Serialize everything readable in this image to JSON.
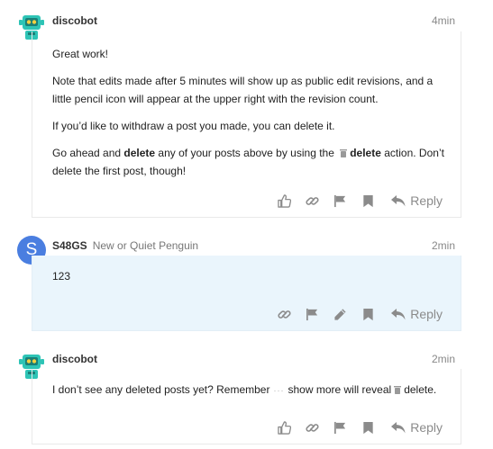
{
  "posts": [
    {
      "username": "discobot",
      "time": "4min",
      "avatar_icon": "robot-avatar-icon",
      "paragraphs": {
        "p1": "Great work!",
        "p2": "Note that edits made after 5 minutes will show up as public edit revisions, and a little pencil icon will appear at the upper right with the revision count.",
        "p3": "If you’d like to withdraw a post you made, you can delete it.",
        "p4_a": "Go ahead and ",
        "p4_b": "delete",
        "p4_c": " any of your posts above by using the ",
        "p4_d": "delete",
        "p4_e": " action. Don’t delete the first post, though!"
      },
      "actions": [
        "like-icon",
        "link-icon",
        "flag-icon",
        "bookmark-icon"
      ],
      "reply_label": "Reply"
    },
    {
      "username": "S48GS",
      "user_title": "New or Quiet Penguin",
      "avatar_letter": "S",
      "time": "2min",
      "text": "123",
      "actions": [
        "link-icon",
        "flag-icon",
        "edit-icon",
        "bookmark-icon"
      ],
      "reply_label": "Reply"
    },
    {
      "username": "discobot",
      "time": "2min",
      "avatar_icon": "robot-avatar-icon",
      "text_a": "I don’t see any deleted posts yet? Remember",
      "text_dots": "···",
      "text_b": "show more will reveal",
      "text_c": "delete.",
      "actions": [
        "like-icon",
        "link-icon",
        "flag-icon",
        "bookmark-icon"
      ],
      "reply_label": "Reply"
    }
  ],
  "colors": {
    "highlight_bg": "#eaf5fc",
    "avatar_blue": "#4a7ee0",
    "robot_teal": "#2ec4b6",
    "icon_gray": "#8b8b8b"
  }
}
